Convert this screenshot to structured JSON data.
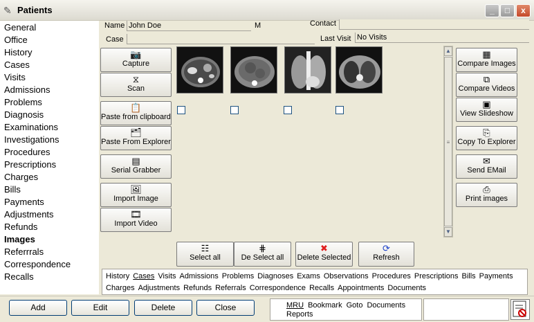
{
  "window": {
    "title": "Patients",
    "min": "_",
    "max": "□",
    "close": "x"
  },
  "nav": [
    "General",
    "Office",
    "History",
    "Cases",
    "Visits",
    "Admissions",
    "Problems",
    "Diagnosis",
    "Examinations",
    "Investigations",
    "Procedures",
    "Prescriptions",
    "Charges",
    "Bills",
    "Payments",
    "Adjustments",
    "Refunds",
    "Images",
    "Referrrals",
    "Correspondence",
    "Recalls"
  ],
  "active_nav": "Images",
  "patient": {
    "name_label": "Name",
    "name_value": "John  Doe",
    "sex": "M",
    "contact_label": "Contact",
    "contact_value": "",
    "case_label": "Case",
    "case_value": "",
    "last_visit_label": "Last Visit",
    "last_visit_value": "No Visits"
  },
  "left_actions": [
    {
      "label": "Capture",
      "icon": "camera-icon"
    },
    {
      "label": "Scan",
      "icon": "scanner-icon"
    },
    {
      "label": "Paste from clipboard",
      "icon": "clipboard-icon"
    },
    {
      "label": "Paste From Explorer",
      "icon": "explorer-icon"
    },
    {
      "label": "Serial Grabber",
      "icon": "grabber-icon"
    },
    {
      "label": "Import Image",
      "icon": "image-icon"
    },
    {
      "label": "Import Video",
      "icon": "film-icon"
    }
  ],
  "right_actions": [
    {
      "label": "Compare Images",
      "icon": "compare-images-icon"
    },
    {
      "label": "Compare Videos",
      "icon": "compare-videos-icon"
    },
    {
      "label": "View Slideshow",
      "icon": "slideshow-icon"
    },
    {
      "label": "Copy To Explorer",
      "icon": "copy-icon"
    },
    {
      "label": "Send  EMail",
      "icon": "email-icon"
    },
    {
      "label": "Print images",
      "icon": "printer-icon"
    }
  ],
  "selection_actions": [
    {
      "label": "Select all",
      "icon": "select-all-icon"
    },
    {
      "label": "De Select all",
      "icon": "deselect-icon"
    },
    {
      "label": "Delete Selected",
      "icon": "delete-icon",
      "color": "#e02020"
    },
    {
      "label": "Refresh",
      "icon": "refresh-icon",
      "color": "#1a3fc8"
    }
  ],
  "images": [
    {
      "kind": "ct-abdomen"
    },
    {
      "kind": "ct-abdomen-mass"
    },
    {
      "kind": "chest-xray"
    },
    {
      "kind": "ct-chest"
    }
  ],
  "links_row1": [
    "History",
    "Cases",
    "Visits",
    "Admissions",
    "Problems",
    "Diagnoses",
    "Exams",
    "Observations",
    "Procedures",
    "Prescriptions",
    "Bills",
    "Payments"
  ],
  "links_row2": [
    "Charges",
    "Adjustments",
    "Refunds",
    "Referrals",
    "Correspondence",
    "Recalls",
    "Appointments",
    "Documents"
  ],
  "underlined_link": "Cases",
  "bottom_buttons": [
    "Add",
    "Edit",
    "Delete",
    "Close"
  ],
  "mru": {
    "items_row1": [
      "MRU",
      "Bookmark",
      "Goto",
      "Documents"
    ],
    "items_row2": [
      "Reports"
    ]
  }
}
